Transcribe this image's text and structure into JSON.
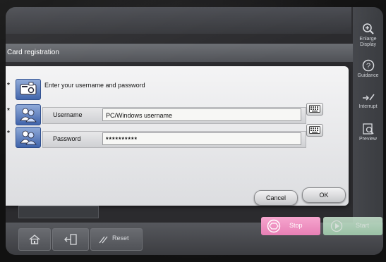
{
  "screen": {
    "title": "Card registration",
    "top_hint": ""
  },
  "dialog": {
    "instruction": "Enter your username and password",
    "fields": [
      {
        "label": "Username",
        "value": "PC/Windows username"
      },
      {
        "label": "Password",
        "value": "**********"
      }
    ],
    "cancel_label": "Cancel",
    "ok_label": "OK",
    "required_marker": "*"
  },
  "right_panel": {
    "enlarge_label_1": "Enlarge",
    "enlarge_label_2": "Display",
    "guidance_label": "Guidance",
    "interrupt_label": "Interrupt",
    "preview_label": "Preview"
  },
  "bottom_bar": {
    "reset_label": "Reset",
    "stop_label": "Stop",
    "start_label": "Start"
  },
  "icons": {
    "home": "home-icon",
    "logout": "logout-icon",
    "reset": "reset-icon",
    "stop": "stop-icon",
    "keyboard": "keyboard-icon",
    "card": "card-icon",
    "user": "user-icon",
    "zoom": "zoom-in-icon",
    "help": "help-icon",
    "interrupt": "interrupt-icon",
    "preview": "preview-icon"
  },
  "colors": {
    "stop": "#e77fb5",
    "start": "#a8d6b4",
    "icon_blue": "#3f63aa"
  }
}
